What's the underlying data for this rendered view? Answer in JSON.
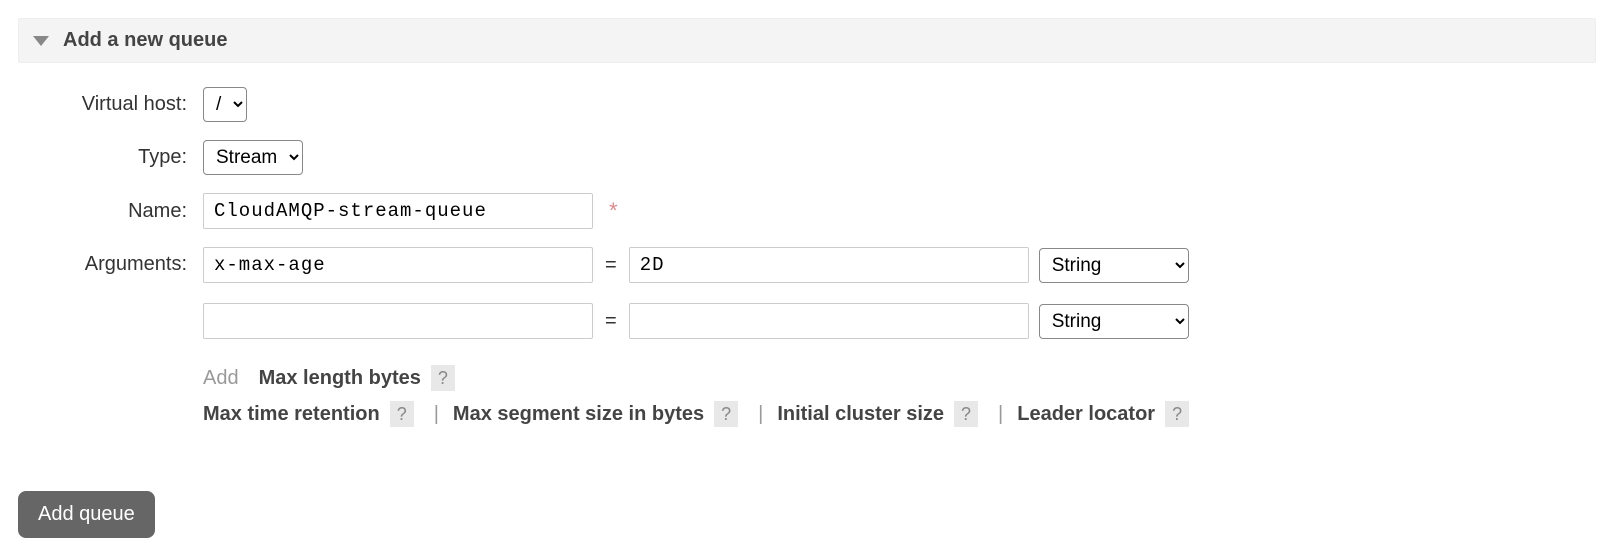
{
  "section": {
    "title": "Add a new queue"
  },
  "form": {
    "labels": {
      "vhost": "Virtual host:",
      "type": "Type:",
      "name": "Name:",
      "arguments": "Arguments:"
    },
    "vhost": {
      "selected": "/"
    },
    "type": {
      "selected": "Stream"
    },
    "name": {
      "value": "CloudAMQP-stream-queue"
    },
    "required_marker": "*",
    "equals": "=",
    "arguments": [
      {
        "key": "x-max-age",
        "value": "2D",
        "type": "String"
      },
      {
        "key": "",
        "value": "",
        "type": "String"
      }
    ],
    "hints": {
      "add_label": "Add",
      "line1": [
        {
          "label": "Max length bytes"
        }
      ],
      "line2": [
        {
          "label": "Max time retention"
        },
        {
          "label": "Max segment size in bytes"
        },
        {
          "label": "Initial cluster size"
        },
        {
          "label": "Leader locator"
        }
      ],
      "sep": "|",
      "help": "?"
    },
    "submit_label": "Add queue"
  }
}
